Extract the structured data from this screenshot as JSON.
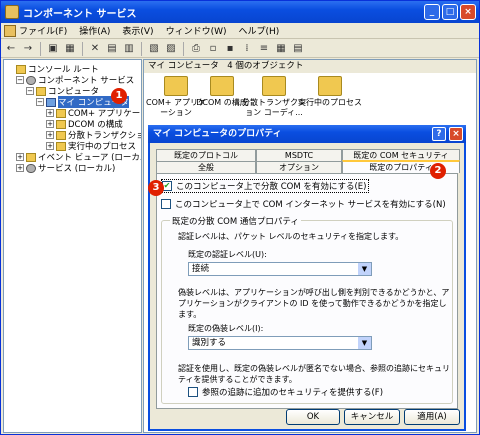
{
  "window": {
    "title": "コンポーネント サービス",
    "min": "_",
    "max": "□",
    "close": "×"
  },
  "menu": [
    "ファイル(F)",
    "操作(A)",
    "表示(V)",
    "ウィンドウ(W)",
    "ヘルプ(H)"
  ],
  "toolbar": [
    "←",
    "→",
    "▣",
    "▦",
    "✕",
    "▤",
    "▥",
    "▧",
    "▨",
    "⎙",
    "▫",
    "▪",
    "⁞",
    "≡",
    "▦",
    "▤"
  ],
  "tree": [
    {
      "label": "コンソール ルート",
      "indent": 0,
      "exp": "",
      "icon": "fold"
    },
    {
      "label": "コンポーネント サービス",
      "indent": 1,
      "exp": "−",
      "icon": "gear"
    },
    {
      "label": "コンピュータ",
      "indent": 2,
      "exp": "−",
      "icon": "fold"
    },
    {
      "label": "マイ コンピュータ",
      "indent": 3,
      "exp": "−",
      "icon": "pc",
      "selected": true
    },
    {
      "label": "COM+ アプリケーション",
      "indent": 4,
      "exp": "+",
      "icon": "fold"
    },
    {
      "label": "DCOM の構成",
      "indent": 4,
      "exp": "+",
      "icon": "fold"
    },
    {
      "label": "分散トランザクション",
      "indent": 4,
      "exp": "+",
      "icon": "fold"
    },
    {
      "label": "実行中のプロセス",
      "indent": 4,
      "exp": "+",
      "icon": "fold"
    },
    {
      "label": "イベント ビューア (ローカル)",
      "indent": 1,
      "exp": "+",
      "icon": "fold"
    },
    {
      "label": "サービス (ローカル)",
      "indent": 1,
      "exp": "+",
      "icon": "gear"
    }
  ],
  "right": {
    "header": "マイ コンピュータ　4 個のオブジェクト",
    "items": [
      "COM+ アプリケーション",
      "DCOM の構成",
      "分散トランザクション コーディ...",
      "実行中のプロセス"
    ]
  },
  "badges": [
    "1",
    "2",
    "3"
  ],
  "dialog": {
    "title": "マイ コンピュータのプロパティ",
    "help": "?",
    "close": "×",
    "tabs_row1": [
      "既定のプロトコル",
      "MSDTC",
      "既定の COM セキュリティ"
    ],
    "tabs_row2": [
      "全般",
      "オプション",
      "既定のプロパティ"
    ],
    "cb1": "このコンピュータ上で分散 COM を有効にする(E)",
    "cb2": "このコンピュータ上で COM インターネット サービスを有効にする(N)",
    "group_title": "既定の分散 COM 通信プロパティ",
    "auth_desc": "認証レベルは、パケット レベルのセキュリティを指定します。",
    "auth_label": "既定の認証レベル(U):",
    "auth_value": "接続",
    "imp_desc": "偽装レベルは、アプリケーションが呼び出し側を判別できるかどうかと、アプリケーションがクライアントの ID を使って動作できるかどうかを指定します。",
    "imp_label": "既定の偽装レベル(I):",
    "imp_value": "識別する",
    "sec_desc": "認証を使用し、既定の偽装レベルが匿名でない場合、参照の追跡にセキュリティを提供することができます。",
    "cb3": "参照の追跡に追加のセキュリティを提供する(F)",
    "ok": "OK",
    "cancel": "キャンセル",
    "apply": "適用(A)"
  }
}
